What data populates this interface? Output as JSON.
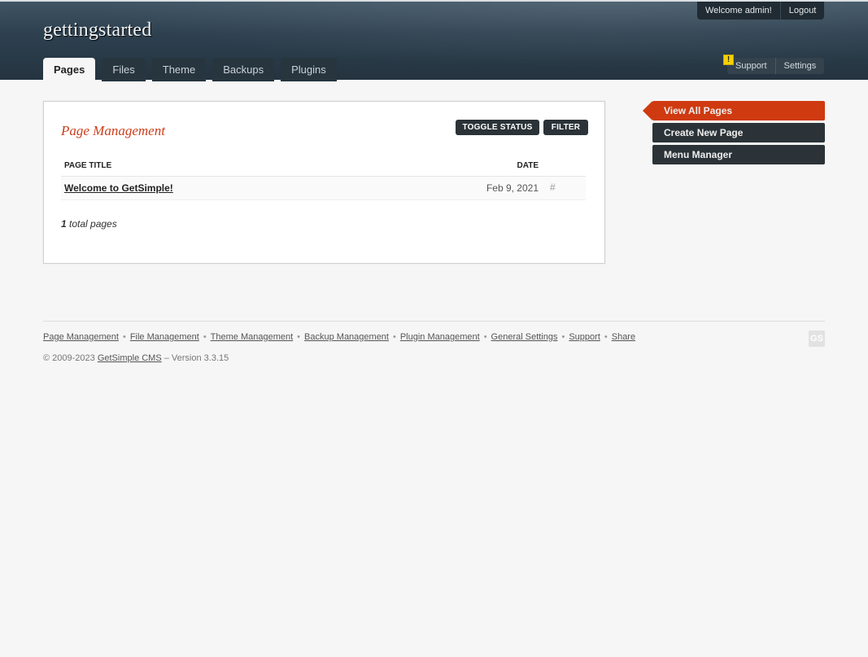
{
  "header": {
    "site_title": "gettingstarted",
    "welcome": "Welcome admin!",
    "logout": "Logout",
    "tabs": [
      {
        "label": "Pages",
        "active": true
      },
      {
        "label": "Files"
      },
      {
        "label": "Theme"
      },
      {
        "label": "Backups"
      },
      {
        "label": "Plugins"
      }
    ],
    "alert_glyph": "!",
    "right_links": [
      "Support",
      "Settings"
    ]
  },
  "main": {
    "heading": "Page Management",
    "toggle_status": "TOGGLE STATUS",
    "filter": "FILTER",
    "columns": {
      "title": "PAGE TITLE",
      "date": "DATE"
    },
    "rows": [
      {
        "title": "Welcome to GetSimple!",
        "date": "Feb 9, 2021",
        "link": "#"
      }
    ],
    "total_count": "1",
    "total_label": " total pages"
  },
  "sidebar": {
    "items": [
      {
        "label": "View All Pages",
        "current": true
      },
      {
        "label": "Create New Page"
      },
      {
        "label": "Menu Manager"
      }
    ]
  },
  "footer": {
    "links": [
      "Page Management",
      "File Management",
      "Theme Management",
      "Backup Management",
      "Plugin Management",
      "General Settings",
      "Support",
      "Share"
    ],
    "separator": "•",
    "copyright_prefix": "© 2009-2023 ",
    "cms_name": "GetSimple CMS",
    "version": " – Version 3.3.15",
    "logo_text": "GS"
  },
  "colors": {
    "accent": "#cf3a10",
    "header_bg": "#2e4150",
    "dark_button": "#2b3338"
  }
}
